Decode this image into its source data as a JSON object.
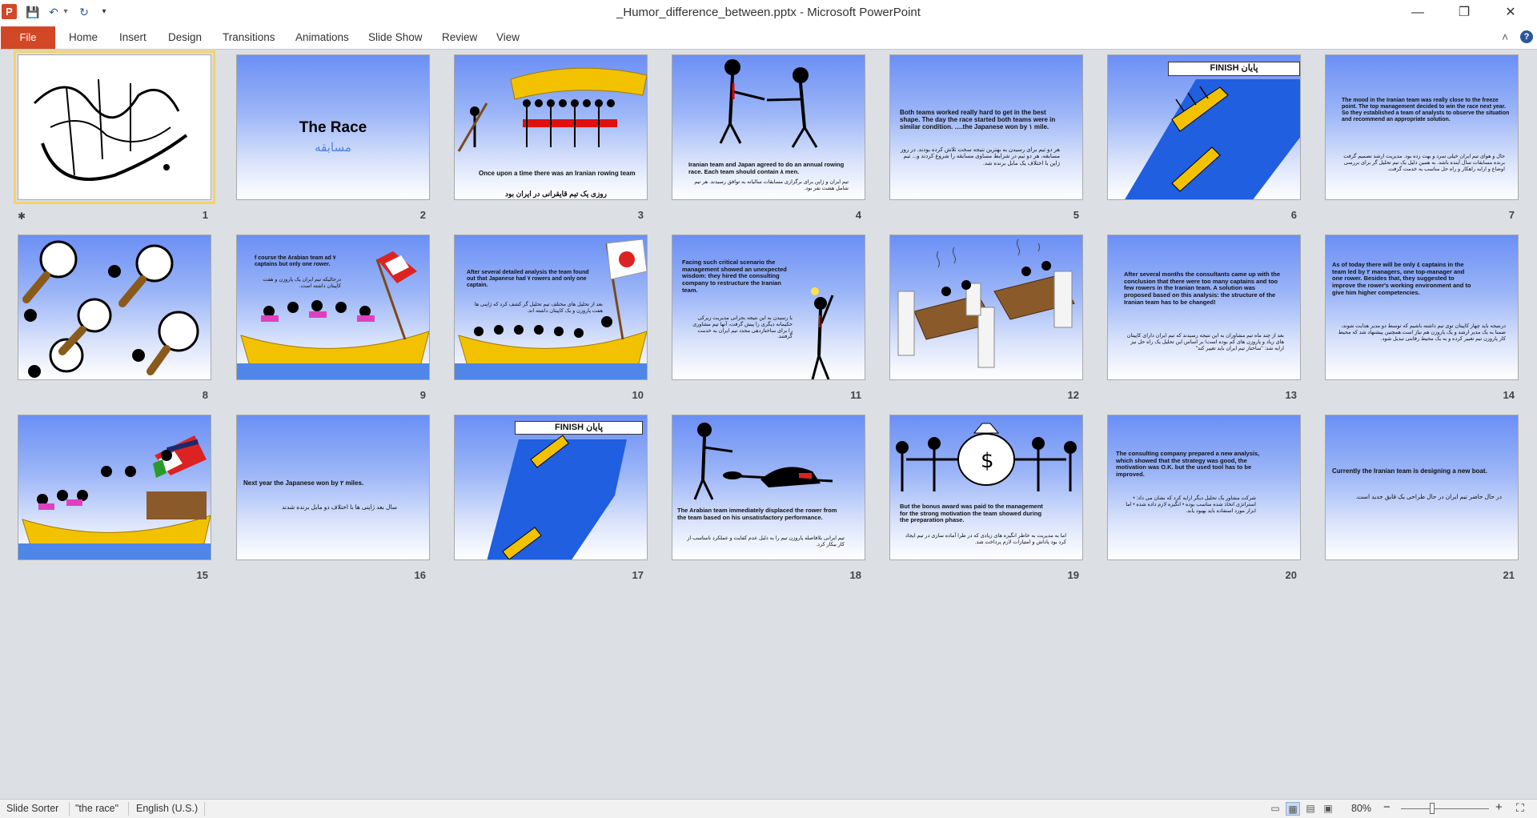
{
  "app": {
    "icon_letter": "P",
    "title": "_Humor_difference_between.pptx - Microsoft PowerPoint",
    "qat": {
      "save": "💾",
      "undo": "↶",
      "undo_drop": "▾",
      "redo": "↻",
      "customize": "▾"
    },
    "window": {
      "minimize": "—",
      "restore": "❐",
      "close": "✕"
    }
  },
  "ribbon": {
    "file": "File",
    "tabs": [
      "Home",
      "Insert",
      "Design",
      "Transitions",
      "Animations",
      "Slide Show",
      "Review",
      "View"
    ],
    "minimize_icon": "chevron-up-icon",
    "minimize_glyph": "˄",
    "help_glyph": "?"
  },
  "slides": [
    {
      "num": "1",
      "calligraphy": "بسم الله الرحمن الرحیم"
    },
    {
      "num": "2",
      "title": "The Race",
      "subtitle": "مسابقه"
    },
    {
      "num": "3",
      "en": "Once upon a time there was an Iranian rowing team",
      "fa": "روزی  یک تیم قایقرانی در ایران بود"
    },
    {
      "num": "4",
      "en": "Iranian team and Japan agreed to do an annual rowing race. Each team should contain ۸ men.",
      "fa": "تیم ایران و ژاپن برای برگزاری مسابقات سالیانه به توافق رسیدند. هر تیم شامل هشت نفر بود."
    },
    {
      "num": "5",
      "en": "Both teams worked really hard to get in the best shape. The day the race started both teams were in similar condition. ….the Japanese won by ۱ mile.",
      "fa": "هر دو تیم برای رسیدن به بهترین نتیجه سخت تلاش کرده بودند. در روز مسابقه، هر دو تیم در شرایط مساوی مسابقه را شروع کردند و... تیم ژاپن با اختلاف یک مایل برنده شد."
    },
    {
      "num": "6",
      "finish": "FINISH  پایان"
    },
    {
      "num": "7",
      "en": "The mood in the Iranian team was really close to the freeze point. The top management decided to win the race next year. So they established a team of analysts to observe the situation and recommend an appropriate solution.",
      "fa": "حال و هوای تیم ایران خیلی سرد و بهت زده بود. مدیریت ارشد تصمیم گرفت برنده مسابقات سال آینده باشد. به همین دلیل یک تیم تحلیل گر برای بررسی اوضاع و ارایه راهکار و راه حل مناسب به خدمت گرفت."
    },
    {
      "num": "8"
    },
    {
      "num": "9",
      "en": "f course the Arabian team ad ۷ captains but only one rower.",
      "fa": "درحالیکه تیم ایران یک پاروزن و هفت کاپیتان داشته است."
    },
    {
      "num": "10",
      "en": "After several detailed analysis the team found out that Japanese had ۷ rowers and only one captain.",
      "fa": "بعد از تحلیل های مختلف تیم تحلیل گر کشف کرد که ژاپنی ها هفت پاروزن و یک کاپیتان داشته اند."
    },
    {
      "num": "11",
      "en": "Facing such critical scenario the management showed an unexpected wisdom: they hired the consulting company to restructure the Iranian team.",
      "fa": "با رسیدن به این نتیجه بحرانی مدیریت زیرکی حکیمانه دیگری را پیش گرفت، آنها تیم مشاوری را برای ساختاردهی مجدد تیم ایران به خدمت گرفتند."
    },
    {
      "num": "12"
    },
    {
      "num": "13",
      "en": "After several months the consultants came up with the conclusion that there were too many captains and too few rowers in the Iranian team. A solution was proposed based on this analysis: the structure of the Iranian team has to be changed!",
      "fa": "بعد از چند ماه تیم مشاوران به این نتیجه رسیدند که تیم ایران دارای کاپیتان های زیاد و پاروزن های کم بوده است! بر اساس این تحلیل یک راه حل نیز ارایه شد: \"ساختار تیم ایران باید تغییر کند\""
    },
    {
      "num": "14",
      "en": "As of today there will be only ٤ captains in the team led by ۲ managers, one top-manager and one rower. Besides that, they suggested to improve the rower's working environment and to give him higher competencies.",
      "fa": "درنتیجه باید چهار کاپیتان توی تیم داشته باشیم که توسط دو مدیر هدایت شوند، ضمنا به یک مدیر ارشد و یک پاروزن هم نیاز است.همچنین پیشنهاد شد که محیط کار پاروزن تیم تغییر کرده و به یک محیط رقابتی تبدیل شود."
    },
    {
      "num": "15"
    },
    {
      "num": "16",
      "en": "Next year the Japanese won by ۲ miles.",
      "fa": "سال بعد ژاپنی ها با اختلاف دو مایل برنده شدند"
    },
    {
      "num": "17",
      "finish": "FINISH  پایان"
    },
    {
      "num": "18",
      "en": "The Arabian team immediately displaced the rower from the team based on his unsatisfactory performance.",
      "fa": "تیم ایرانی بلافاصله پاروزن تیم را به دلیل عدم کفایت و عملکرد نامناسب از کار بیکار کرد."
    },
    {
      "num": "19",
      "en": "But the bonus award was paid to the management for the strong motivation the team showed during the preparation phase.",
      "fa": "اما به مدیریت به خاطر انگیزه های زیادی که در طرا آماده سازی در تیم ایجاد کرد بود پاداش و امتیازات لازم پرداخت شد."
    },
    {
      "num": "20",
      "en": "The consulting company prepared a new analysis, which showed that the strategy was good, the motivation was O.K. but the used tool has to be improved.",
      "fa": "شرکت مشاور یک تحلیل دیگر ارایه کرد که نشان می داد: • استراتژی اتخاذ شده مناسب بوده • انگیزه لازم داده شده • اما ابزار مورد استفاده باید بهبود یابد."
    },
    {
      "num": "21",
      "en": "Currently the Iranian team is designing a new boat.",
      "fa": "در حال حاضر تیم ایران در حال طراحی یک قایق جدید است."
    }
  ],
  "status": {
    "view": "Slide Sorter",
    "theme": "\"the race\"",
    "language": "English (U.S.)",
    "zoom": "80%",
    "zoom_out": "−",
    "zoom_in": "+",
    "fit": "⛶",
    "views": [
      "▭",
      "▦",
      "▤",
      "▣"
    ]
  }
}
